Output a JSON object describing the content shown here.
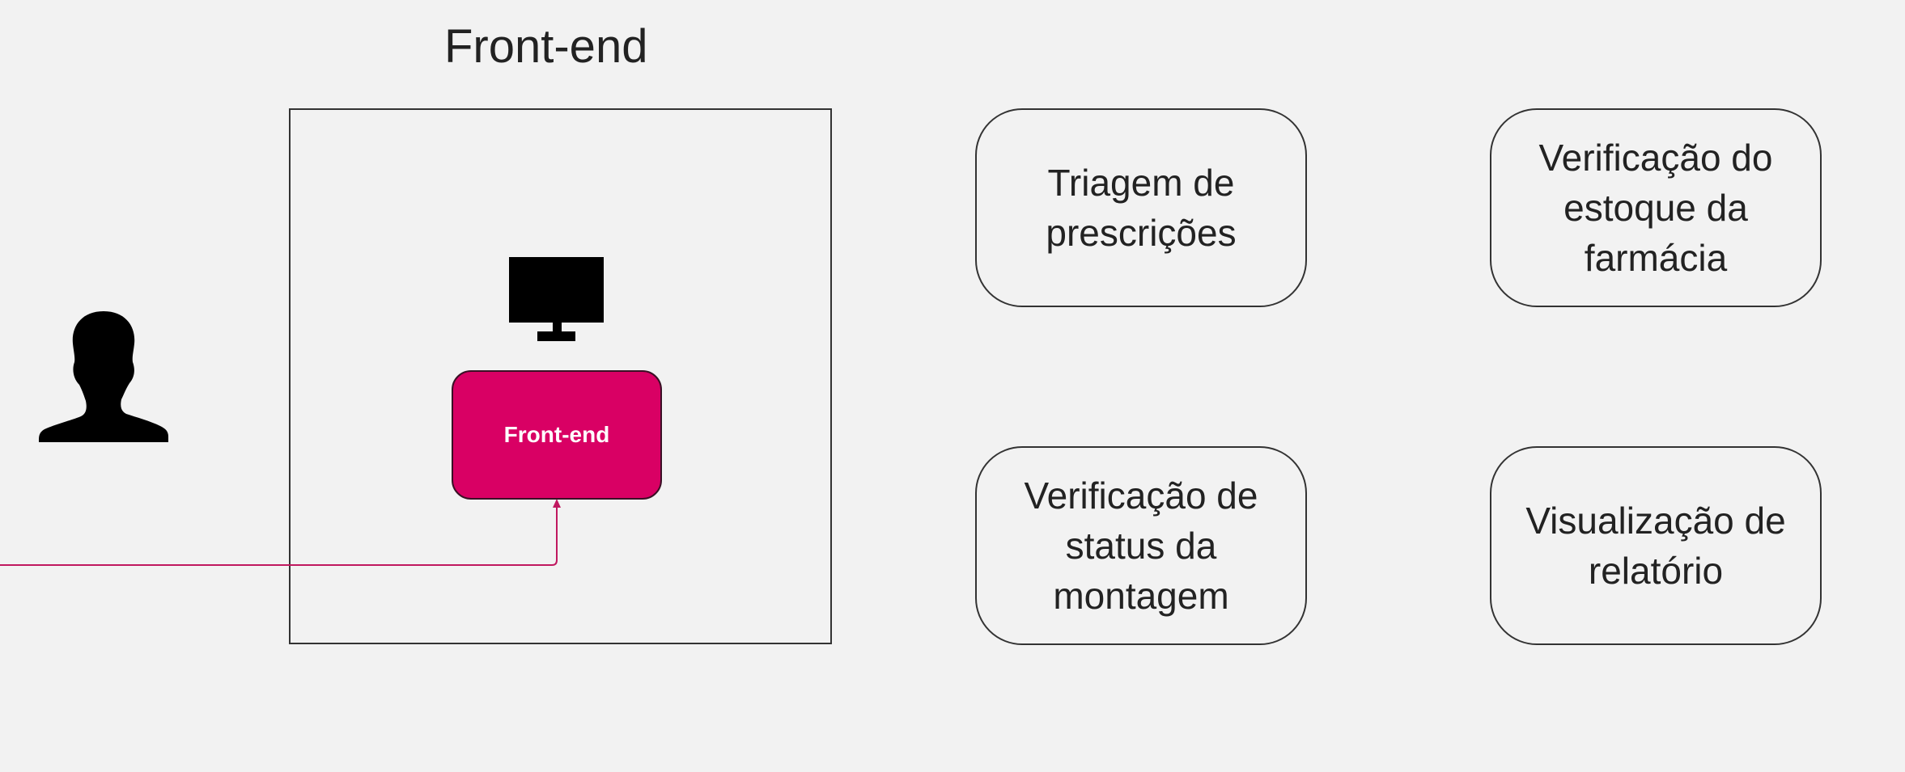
{
  "diagram": {
    "group_title": "Front-end",
    "frontend_box_label": "Front-end",
    "modules": [
      {
        "label": "Triagem de prescrições"
      },
      {
        "label": "Verificação do estoque da farmácia"
      },
      {
        "label": "Verificação de status da montagem"
      },
      {
        "label": "Visualização de relatório"
      }
    ],
    "icons": {
      "user": "user-silhouette-icon",
      "computer": "monitor-icon"
    },
    "colors": {
      "background": "#f2f2f2",
      "frontend_fill": "#d90064",
      "connector": "#c0185f",
      "outline": "#333333"
    }
  }
}
